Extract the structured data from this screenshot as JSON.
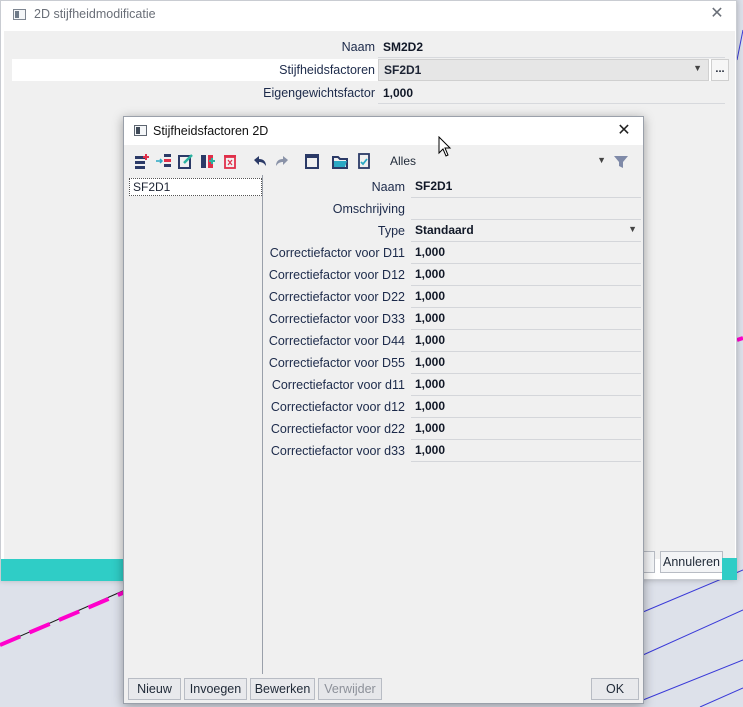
{
  "outer_window": {
    "title": "2D stijfheidmodificatie",
    "properties": [
      {
        "label": "Naam",
        "value": "SM2D2"
      },
      {
        "label": "Stijfheidsfactoren",
        "value": "SF2D1",
        "ellipsis": "..."
      },
      {
        "label": "Eigengewichtsfactor",
        "value": "1,000"
      }
    ],
    "cancel_label": "Annuleren"
  },
  "dialog": {
    "title": "Stijfheidsfactoren 2D",
    "toolbar": {
      "filter_value": "Alles",
      "icons": [
        "new-item-icon",
        "insert-icon",
        "edit-icon",
        "copy-icon",
        "delete-icon",
        "undo-icon",
        "redo-icon",
        "save-icon",
        "open-folder-icon",
        "check-document-icon"
      ]
    },
    "list": [
      "SF2D1"
    ],
    "fields": [
      {
        "label": "Naam",
        "value": "SF2D1"
      },
      {
        "label": "Omschrijving",
        "value": ""
      },
      {
        "label": "Type",
        "value": "Standaard",
        "dropdown": true
      },
      {
        "label": "Correctiefactor voor D11",
        "value": "1,000"
      },
      {
        "label": "Correctiefactor voor D12",
        "value": "1,000"
      },
      {
        "label": "Correctiefactor voor D22",
        "value": "1,000"
      },
      {
        "label": "Correctiefactor voor D33",
        "value": "1,000"
      },
      {
        "label": "Correctiefactor voor D44",
        "value": "1,000"
      },
      {
        "label": "Correctiefactor voor D55",
        "value": "1,000"
      },
      {
        "label": "Correctiefactor voor d11",
        "value": "1,000"
      },
      {
        "label": "Correctiefactor voor d12",
        "value": "1,000"
      },
      {
        "label": "Correctiefactor voor d22",
        "value": "1,000"
      },
      {
        "label": "Correctiefactor voor d33",
        "value": "1,000"
      }
    ],
    "buttons": {
      "new": "Nieuw",
      "insert": "Invoegen",
      "edit": "Bewerken",
      "delete": "Verwijder",
      "ok": "OK"
    }
  },
  "colors": {
    "accent_teal": "#2fcdc6",
    "cad_line_blue": "#3a3ad8",
    "cad_line_magenta": "#ff00cc"
  }
}
